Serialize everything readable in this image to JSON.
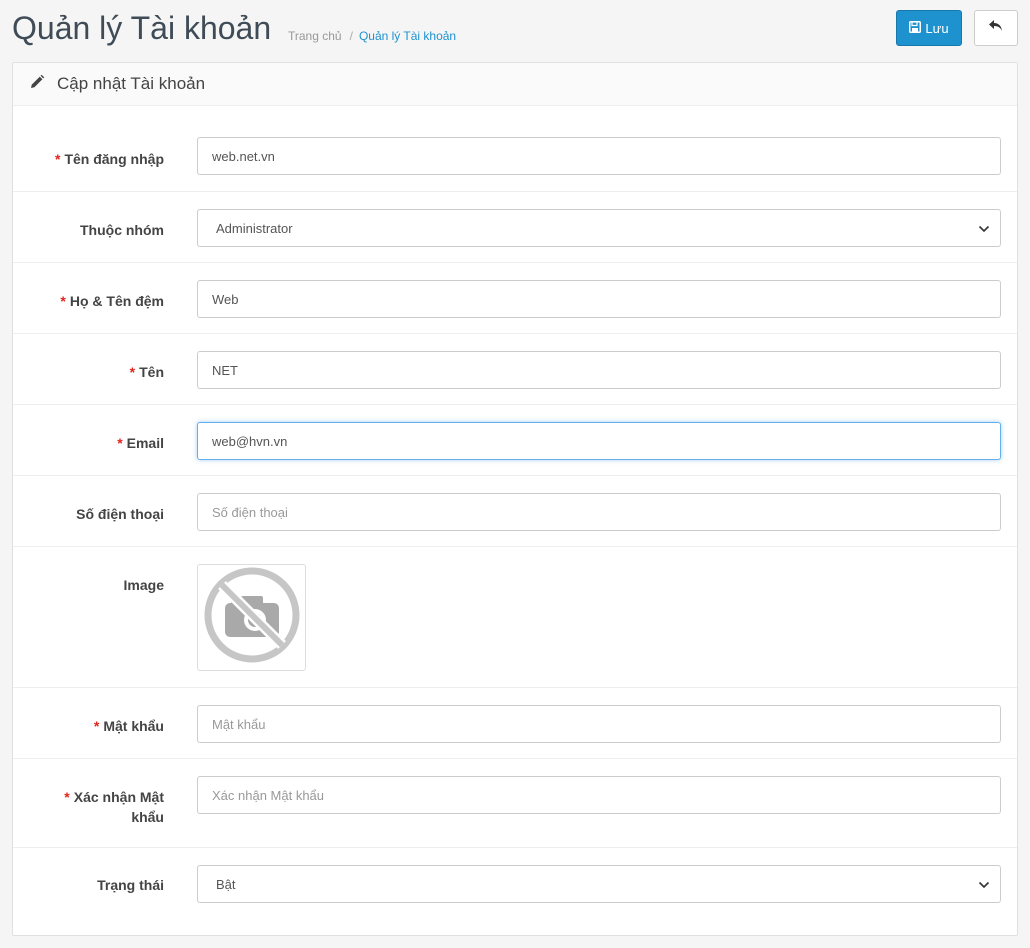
{
  "header": {
    "title": "Quản lý Tài khoản",
    "breadcrumb": [
      {
        "label": "Trang chủ"
      },
      {
        "label": "Quản lý Tài khoản"
      }
    ],
    "save_label": "Lưu"
  },
  "panel": {
    "heading": "Cập nhật Tài khoản"
  },
  "form": {
    "username": {
      "label": "Tên đăng nhập",
      "required": true,
      "value": "web.net.vn"
    },
    "group": {
      "label": "Thuộc nhóm",
      "required": false,
      "selected": "Administrator"
    },
    "firstname": {
      "label": "Họ & Tên đệm",
      "required": true,
      "value": "Web"
    },
    "lastname": {
      "label": "Tên",
      "required": true,
      "value": "NET"
    },
    "email": {
      "label": "Email",
      "required": true,
      "value": "web@hvn.vn"
    },
    "phone": {
      "label": "Số điện thoại",
      "required": false,
      "value": "",
      "placeholder": "Số điện thoại"
    },
    "image": {
      "label": "Image"
    },
    "password": {
      "label": "Mật khẩu",
      "required": true,
      "value": "",
      "placeholder": "Mật khẩu"
    },
    "confirm": {
      "label_line1": "Xác nhận Mật",
      "label_line2": "khẩu",
      "required": true,
      "value": "",
      "placeholder": "Xác nhận Mật khẩu"
    },
    "status": {
      "label": "Trạng thái",
      "required": false,
      "selected": "Bật"
    }
  },
  "icons": {
    "save": "floppy-disk-icon",
    "back": "reply-arrow-icon",
    "heading": "pencil-icon",
    "image": "no-camera-icon",
    "select": "chevron-down-icon"
  },
  "colors": {
    "primary": "#1e91cf",
    "required": "#e3241d",
    "title": "#3f4b56"
  }
}
